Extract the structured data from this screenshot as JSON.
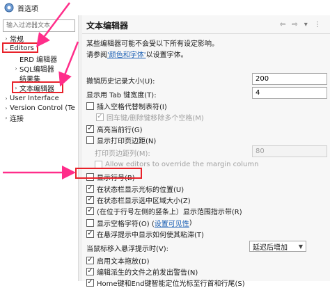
{
  "window": {
    "title": "首选项"
  },
  "filter": {
    "placeholder": "输入过滤器文本"
  },
  "tree": {
    "general": "常规",
    "editors": "Editors",
    "erd_editor": "ERD 编辑器",
    "sql_editor": "SQL编辑器",
    "result_set": "结果集",
    "text_editor": "文本编辑器",
    "user_interface": "User Interface",
    "version_control": "Version Control (Te",
    "connection": "连接"
  },
  "panel": {
    "title": "文本编辑器",
    "nav_icons": "⇦ ⇨ ▾ ⋮",
    "intro": "某些编辑器可能不会受以下所有设定影响。",
    "see_prefix": "请参阅",
    "see_link": "'颜色和字体'",
    "see_suffix": "以设置字体。",
    "undo_label": "撤销历史记录大小(U):",
    "undo_value": "200",
    "tab_label": "显示用 Tab 键宽度(T):",
    "tab_value": "4",
    "insert_spaces": "插入空格代替制表符(I)",
    "backspace_remove": "回车键/删除键移除多个空格(M)",
    "highlight_line": "高亮当前行(G)",
    "show_print_margin": "显示打印页边距(N)",
    "print_margin_col_label": "打印页边距列(M):",
    "print_margin_col_value": "80",
    "allow_override": "Allow editors to override the margin column",
    "show_line_numbers": "显示行号(B)",
    "status_cursor_pos": "在状态栏显示光标的位置(U)",
    "status_selection_size": "在状态栏显示选中区域大小(Z)",
    "range_indicator": "(在位于行号左侧的竖条上）显示范围指示带(R)",
    "show_whitespace_prefix": "显示空格字符(O) (",
    "show_whitespace_link": "设置可见性",
    "show_whitespace_suffix": ")",
    "hover_affordance": "在悬浮提示中显示如何使其粘滞(T)",
    "hover_mod_label": "当鼠标移入悬浮提示时(V):",
    "hover_mod_value": "延迟后增加",
    "enable_drag_drop": "启用文本拖放(D)",
    "warn_derived": "编辑派生的文件之前发出警告(N)",
    "smart_home_end": "Home键和End键智能定位光标至行首和行尾(S)"
  },
  "colors": {
    "annotation": "#e8222a",
    "arrow": "#ff2d8a",
    "link": "#1a5fb4"
  }
}
